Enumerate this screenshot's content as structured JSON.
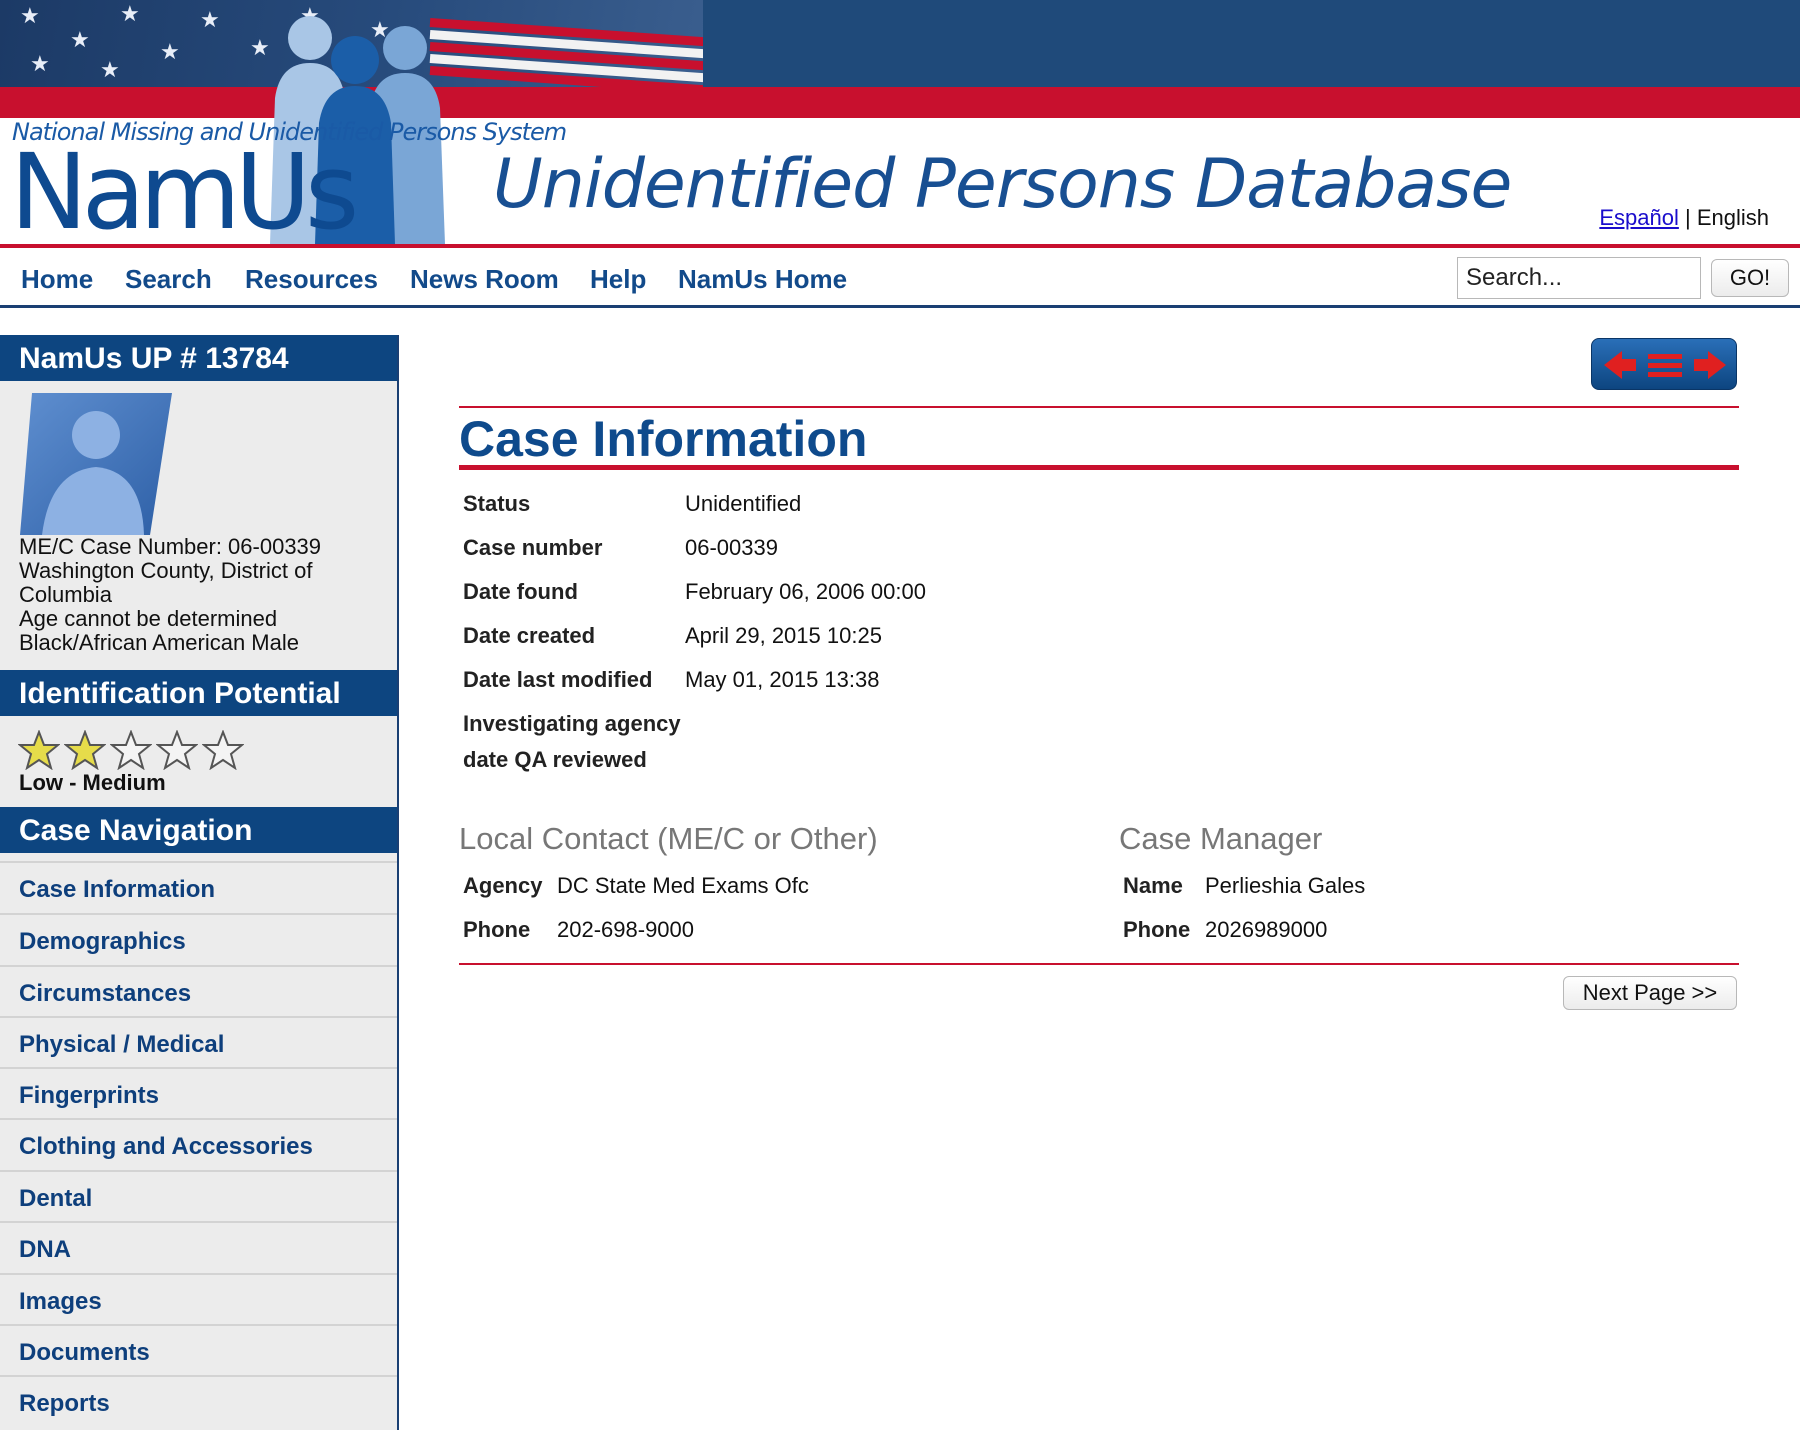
{
  "header": {
    "org_name": "National Missing and Unidentified Persons System",
    "logo_text": "NamUs",
    "database_title": "Unidentified Persons Database",
    "lang_spanish": "Español",
    "lang_separator": "|",
    "lang_english": "English"
  },
  "nav": {
    "items": [
      "Home",
      "Search",
      "Resources",
      "News Room",
      "Help",
      "NamUs Home"
    ],
    "search_placeholder": "Search...",
    "go_label": "GO!"
  },
  "sidebar": {
    "case_title": "NamUs UP # 13784",
    "case_lines": [
      "ME/C Case Number: 06-00339",
      "Washington County, District of",
      "Columbia",
      "Age cannot be determined",
      "Black/African American Male"
    ],
    "id_potential_title": "Identification Potential",
    "id_potential_rating": 2,
    "id_potential_max": 5,
    "id_potential_label": "Low - Medium",
    "case_nav_title": "Case Navigation",
    "case_nav_items": [
      "Case Information",
      "Demographics",
      "Circumstances",
      "Physical / Medical",
      "Fingerprints",
      "Clothing and Accessories",
      "Dental",
      "DNA",
      "Images",
      "Documents",
      "Reports"
    ]
  },
  "main": {
    "title": "Case Information",
    "info_rows": [
      {
        "label": "Status",
        "value": "Unidentified"
      },
      {
        "label": "Case number",
        "value": "06-00339"
      },
      {
        "label": "Date found",
        "value": "February 06, 2006 00:00"
      },
      {
        "label": "Date created",
        "value": "April 29, 2015 10:25"
      },
      {
        "label": "Date last modified",
        "value": "May 01, 2015 13:38"
      },
      {
        "label": "Investigating agency",
        "value": ""
      },
      {
        "label": "date QA reviewed",
        "value": ""
      }
    ],
    "local_contact": {
      "title": "Local Contact (ME/C or Other)",
      "agency_label": "Agency",
      "agency_value": "DC State Med Exams Ofc",
      "phone_label": "Phone",
      "phone_value": "202-698-9000"
    },
    "case_manager": {
      "title": "Case Manager",
      "name_label": "Name",
      "name_value": "Perlieshia Gales",
      "phone_label": "Phone",
      "phone_value": "2026989000"
    },
    "next_page_label": "Next Page >>"
  },
  "colors": {
    "brand_blue": "#0d4580",
    "accent_red": "#c8102e",
    "link_blue": "#124a8a",
    "star_fill": "#e6dc4a"
  }
}
